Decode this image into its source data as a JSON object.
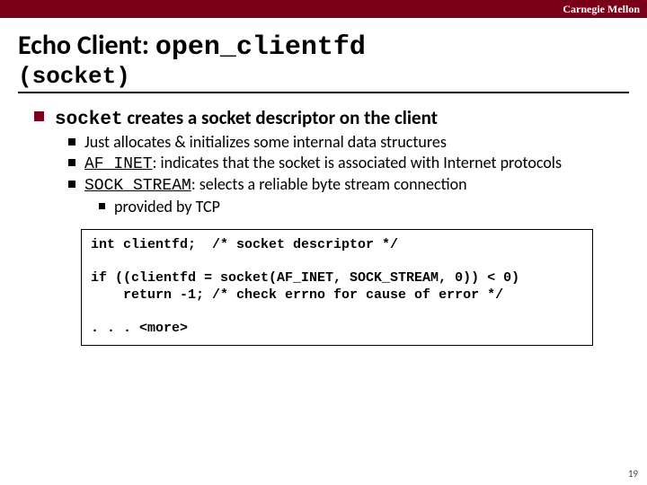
{
  "header": {
    "brand": "Carnegie Mellon"
  },
  "title": {
    "prefix": "Echo Client: ",
    "func": "open_clientfd",
    "subtitle": "(socket)"
  },
  "bullet": {
    "code": "socket",
    "rest": " creates a socket descriptor on the client",
    "subs": [
      {
        "text": "Just allocates & initializes some internal data structures"
      },
      {
        "code": "AF_INET",
        "after": ": indicates that the socket is associated with Internet protocols"
      },
      {
        "code": "SOCK_STREAM",
        "after": ": selects a reliable byte stream connection",
        "sub": {
          "text": "provided by TCP"
        }
      }
    ]
  },
  "code": {
    "l1": "int clientfd;  /* socket descriptor */",
    "l2": "",
    "l3": "if ((clientfd = socket(AF_INET, SOCK_STREAM, 0)) < 0)",
    "l4": "    return -1; /* check errno for cause of error */",
    "l5": "",
    "l6": ". . . <more>"
  },
  "page": "19"
}
